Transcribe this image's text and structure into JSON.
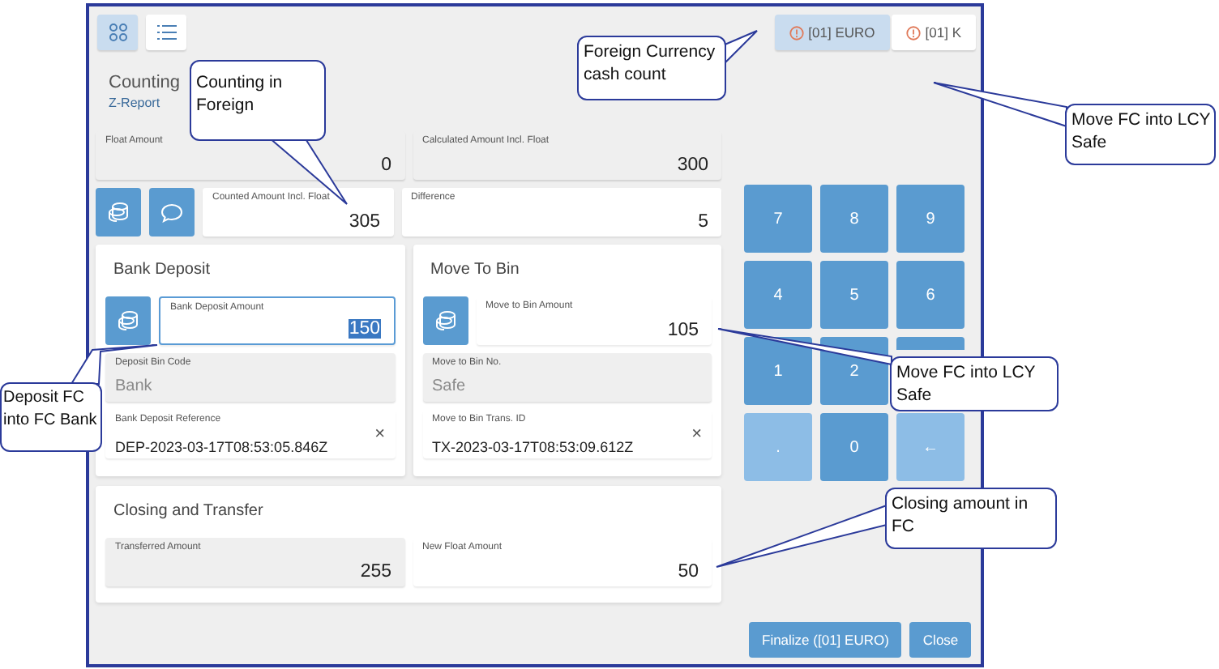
{
  "view_buttons": [
    {
      "kind": "grid",
      "selected": true
    },
    {
      "kind": "list",
      "selected": false
    }
  ],
  "currency_tabs": [
    {
      "label": "[01] EURO",
      "selected": true
    },
    {
      "label": "[01] K",
      "selected": false
    }
  ],
  "counting": {
    "title": "Counting",
    "subtitle": "Z-Report",
    "fields": [
      {
        "label": "Float Amount",
        "value": "0",
        "readonly": true
      },
      {
        "label": "Calculated Amount Incl. Float",
        "value": "300",
        "readonly": true
      },
      {
        "label": "Counted Amount Incl. Float",
        "value": "305",
        "readonly": false
      },
      {
        "label": "Difference",
        "value": "5",
        "readonly": false
      }
    ]
  },
  "panels": [
    {
      "title": "Bank Deposit",
      "amount": {
        "label": "Bank Deposit Amount",
        "value": "150",
        "focused": true
      },
      "bin": {
        "label": "Deposit Bin Code",
        "value": "Bank"
      },
      "reference": {
        "label": "Bank Deposit Reference",
        "value": "DEP-2023-03-17T08:53:05.846Z",
        "clear": "×"
      }
    },
    {
      "title": "Move To Bin",
      "amount": {
        "label": "Move to Bin Amount",
        "value": "105",
        "focused": false
      },
      "bin": {
        "label": "Move to Bin No.",
        "value": "Safe"
      },
      "reference": {
        "label": "Move to Bin Trans. ID",
        "value": "TX-2023-03-17T08:53:09.612Z",
        "clear": "×"
      }
    }
  ],
  "closing": {
    "title": "Closing and Transfer",
    "fields": [
      {
        "label": "Transferred Amount",
        "value": "255",
        "readonly": true
      },
      {
        "label": "New Float Amount",
        "value": "50",
        "readonly": false
      }
    ]
  },
  "keypad": [
    {
      "kind": "key",
      "label": "7",
      "disabled": false
    },
    {
      "kind": "key",
      "label": "8",
      "disabled": false
    },
    {
      "kind": "key",
      "label": "9",
      "disabled": false
    },
    {
      "kind": "key",
      "label": "4",
      "disabled": false
    },
    {
      "kind": "key",
      "label": "5",
      "disabled": false
    },
    {
      "kind": "key",
      "label": "6",
      "disabled": false
    },
    {
      "kind": "key",
      "label": "1",
      "disabled": false
    },
    {
      "kind": "key",
      "label": "2",
      "disabled": false
    },
    {
      "kind": "covered"
    },
    {
      "kind": "key",
      "label": ".",
      "disabled": true
    },
    {
      "kind": "key",
      "label": "0",
      "disabled": false
    },
    {
      "kind": "key",
      "label": "←",
      "disabled": true
    }
  ],
  "actions": [
    {
      "label": "Finalize ([01] EURO)"
    },
    {
      "label": "Close"
    }
  ],
  "callouts": [
    {
      "lines": [
        "Counting in",
        "Foreign"
      ]
    },
    {
      "lines": [
        "Foreign Currency",
        "cash count"
      ]
    },
    {
      "lines": [
        "Move FC into LCY",
        "Safe"
      ]
    },
    {
      "lines": [
        "Move FC into LCY",
        "Safe"
      ]
    },
    {
      "lines": [
        "Deposit FC",
        "into FC Bank"
      ]
    },
    {
      "lines": [
        "Closing amount in",
        "FC"
      ]
    }
  ]
}
